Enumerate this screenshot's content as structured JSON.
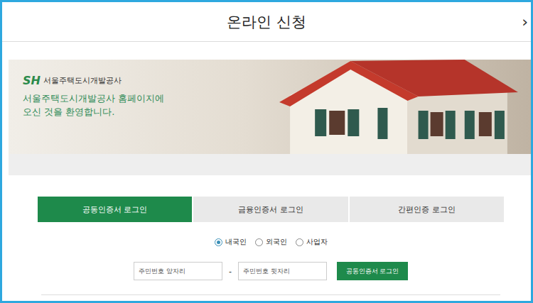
{
  "window": {
    "title": "온라인 신청",
    "close": "›"
  },
  "banner": {
    "logo_mark": "SH",
    "logo_text": "서울주택도시개발공사",
    "welcome_lines": [
      "서울주택도시개발공사 홈페이지에",
      "오신 것을 환영합니다."
    ]
  },
  "tabs": [
    {
      "label": "공동인증서 로그인",
      "selected": true
    },
    {
      "label": "금융인증서 로그인",
      "selected": false
    },
    {
      "label": "간편인증 로그인",
      "selected": false
    }
  ],
  "user_types": [
    {
      "label": "내국인",
      "selected": true
    },
    {
      "label": "외국인",
      "selected": false
    },
    {
      "label": "사업자",
      "selected": false
    }
  ],
  "form": {
    "fields": [
      {
        "placeholder": "주민번호 앞자리"
      },
      {
        "placeholder": "주민번호 뒷자리"
      }
    ],
    "separator": "-",
    "submit": "공동인증서 로그인"
  }
}
